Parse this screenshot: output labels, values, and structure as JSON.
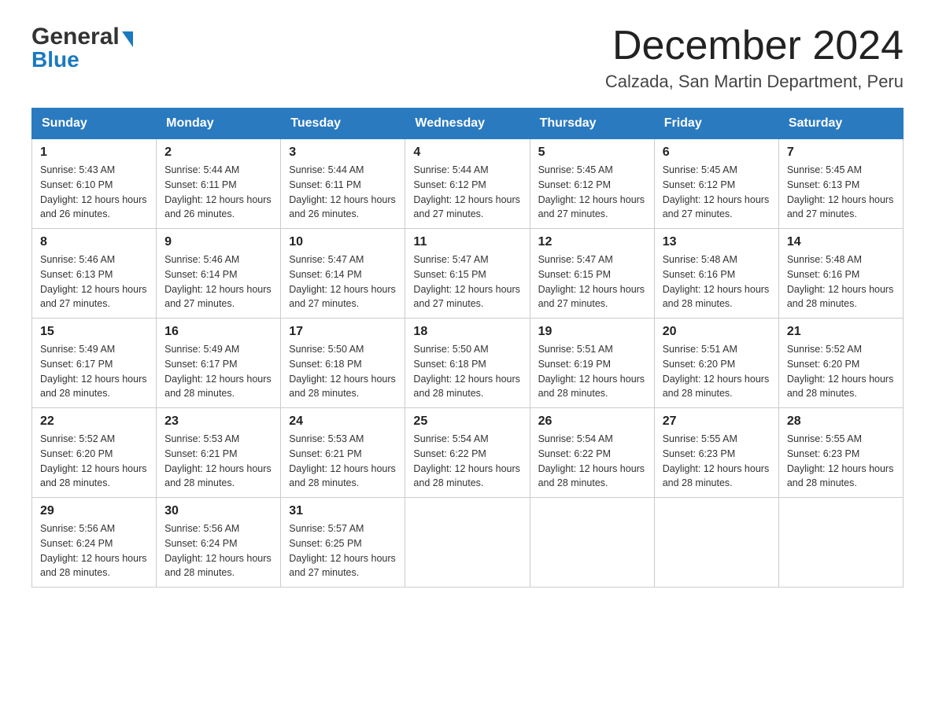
{
  "header": {
    "logo_line1": "General",
    "logo_line2": "Blue",
    "month_title": "December 2024",
    "subtitle": "Calzada, San Martin Department, Peru"
  },
  "days_of_week": [
    "Sunday",
    "Monday",
    "Tuesday",
    "Wednesday",
    "Thursday",
    "Friday",
    "Saturday"
  ],
  "weeks": [
    [
      {
        "day": "1",
        "sunrise": "5:43 AM",
        "sunset": "6:10 PM",
        "daylight": "12 hours and 26 minutes."
      },
      {
        "day": "2",
        "sunrise": "5:44 AM",
        "sunset": "6:11 PM",
        "daylight": "12 hours and 26 minutes."
      },
      {
        "day": "3",
        "sunrise": "5:44 AM",
        "sunset": "6:11 PM",
        "daylight": "12 hours and 26 minutes."
      },
      {
        "day": "4",
        "sunrise": "5:44 AM",
        "sunset": "6:12 PM",
        "daylight": "12 hours and 27 minutes."
      },
      {
        "day": "5",
        "sunrise": "5:45 AM",
        "sunset": "6:12 PM",
        "daylight": "12 hours and 27 minutes."
      },
      {
        "day": "6",
        "sunrise": "5:45 AM",
        "sunset": "6:12 PM",
        "daylight": "12 hours and 27 minutes."
      },
      {
        "day": "7",
        "sunrise": "5:45 AM",
        "sunset": "6:13 PM",
        "daylight": "12 hours and 27 minutes."
      }
    ],
    [
      {
        "day": "8",
        "sunrise": "5:46 AM",
        "sunset": "6:13 PM",
        "daylight": "12 hours and 27 minutes."
      },
      {
        "day": "9",
        "sunrise": "5:46 AM",
        "sunset": "6:14 PM",
        "daylight": "12 hours and 27 minutes."
      },
      {
        "day": "10",
        "sunrise": "5:47 AM",
        "sunset": "6:14 PM",
        "daylight": "12 hours and 27 minutes."
      },
      {
        "day": "11",
        "sunrise": "5:47 AM",
        "sunset": "6:15 PM",
        "daylight": "12 hours and 27 minutes."
      },
      {
        "day": "12",
        "sunrise": "5:47 AM",
        "sunset": "6:15 PM",
        "daylight": "12 hours and 27 minutes."
      },
      {
        "day": "13",
        "sunrise": "5:48 AM",
        "sunset": "6:16 PM",
        "daylight": "12 hours and 28 minutes."
      },
      {
        "day": "14",
        "sunrise": "5:48 AM",
        "sunset": "6:16 PM",
        "daylight": "12 hours and 28 minutes."
      }
    ],
    [
      {
        "day": "15",
        "sunrise": "5:49 AM",
        "sunset": "6:17 PM",
        "daylight": "12 hours and 28 minutes."
      },
      {
        "day": "16",
        "sunrise": "5:49 AM",
        "sunset": "6:17 PM",
        "daylight": "12 hours and 28 minutes."
      },
      {
        "day": "17",
        "sunrise": "5:50 AM",
        "sunset": "6:18 PM",
        "daylight": "12 hours and 28 minutes."
      },
      {
        "day": "18",
        "sunrise": "5:50 AM",
        "sunset": "6:18 PM",
        "daylight": "12 hours and 28 minutes."
      },
      {
        "day": "19",
        "sunrise": "5:51 AM",
        "sunset": "6:19 PM",
        "daylight": "12 hours and 28 minutes."
      },
      {
        "day": "20",
        "sunrise": "5:51 AM",
        "sunset": "6:20 PM",
        "daylight": "12 hours and 28 minutes."
      },
      {
        "day": "21",
        "sunrise": "5:52 AM",
        "sunset": "6:20 PM",
        "daylight": "12 hours and 28 minutes."
      }
    ],
    [
      {
        "day": "22",
        "sunrise": "5:52 AM",
        "sunset": "6:20 PM",
        "daylight": "12 hours and 28 minutes."
      },
      {
        "day": "23",
        "sunrise": "5:53 AM",
        "sunset": "6:21 PM",
        "daylight": "12 hours and 28 minutes."
      },
      {
        "day": "24",
        "sunrise": "5:53 AM",
        "sunset": "6:21 PM",
        "daylight": "12 hours and 28 minutes."
      },
      {
        "day": "25",
        "sunrise": "5:54 AM",
        "sunset": "6:22 PM",
        "daylight": "12 hours and 28 minutes."
      },
      {
        "day": "26",
        "sunrise": "5:54 AM",
        "sunset": "6:22 PM",
        "daylight": "12 hours and 28 minutes."
      },
      {
        "day": "27",
        "sunrise": "5:55 AM",
        "sunset": "6:23 PM",
        "daylight": "12 hours and 28 minutes."
      },
      {
        "day": "28",
        "sunrise": "5:55 AM",
        "sunset": "6:23 PM",
        "daylight": "12 hours and 28 minutes."
      }
    ],
    [
      {
        "day": "29",
        "sunrise": "5:56 AM",
        "sunset": "6:24 PM",
        "daylight": "12 hours and 28 minutes."
      },
      {
        "day": "30",
        "sunrise": "5:56 AM",
        "sunset": "6:24 PM",
        "daylight": "12 hours and 28 minutes."
      },
      {
        "day": "31",
        "sunrise": "5:57 AM",
        "sunset": "6:25 PM",
        "daylight": "12 hours and 27 minutes."
      },
      null,
      null,
      null,
      null
    ]
  ],
  "labels": {
    "sunrise": "Sunrise:",
    "sunset": "Sunset:",
    "daylight": "Daylight:"
  }
}
